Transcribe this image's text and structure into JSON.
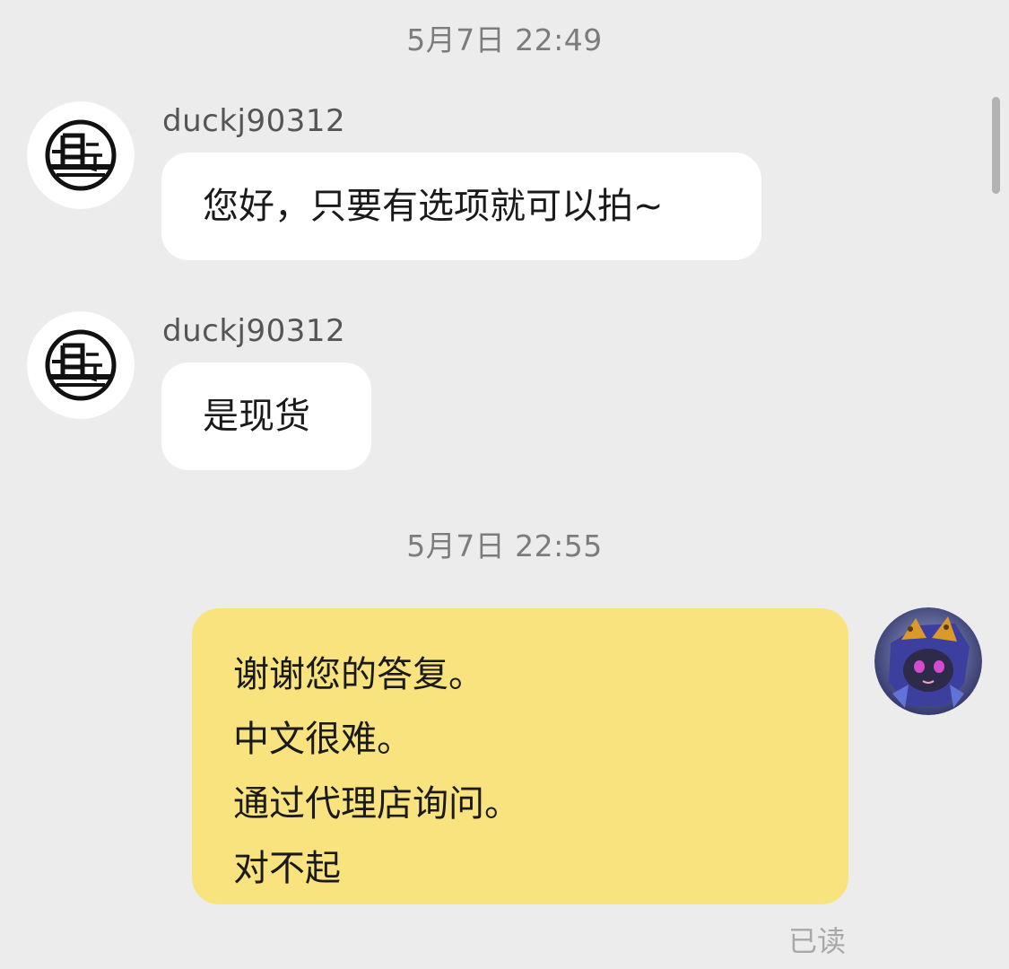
{
  "timestamps": [
    "5月7日 22:49",
    "5月7日 22:55"
  ],
  "messages": [
    {
      "sender": "duckj90312",
      "text": "您好，只要有选项就可以拍~",
      "avatar": "moon-seal-avatar"
    },
    {
      "sender": "duckj90312",
      "text": "是现货",
      "avatar": "moon-seal-avatar"
    }
  ],
  "reply": {
    "lines": [
      "谢谢您的答复。",
      "中文很难。",
      "通过代理店询问。",
      "对不起"
    ],
    "avatar": "user-character-avatar",
    "status": "已读"
  },
  "colors": {
    "background": "#ececec",
    "incoming_bubble": "#ffffff",
    "outgoing_bubble": "#f8e37f",
    "timestamp_text": "#7c7c7c",
    "sender_text": "#555555",
    "read_text": "#a8a8a8"
  }
}
